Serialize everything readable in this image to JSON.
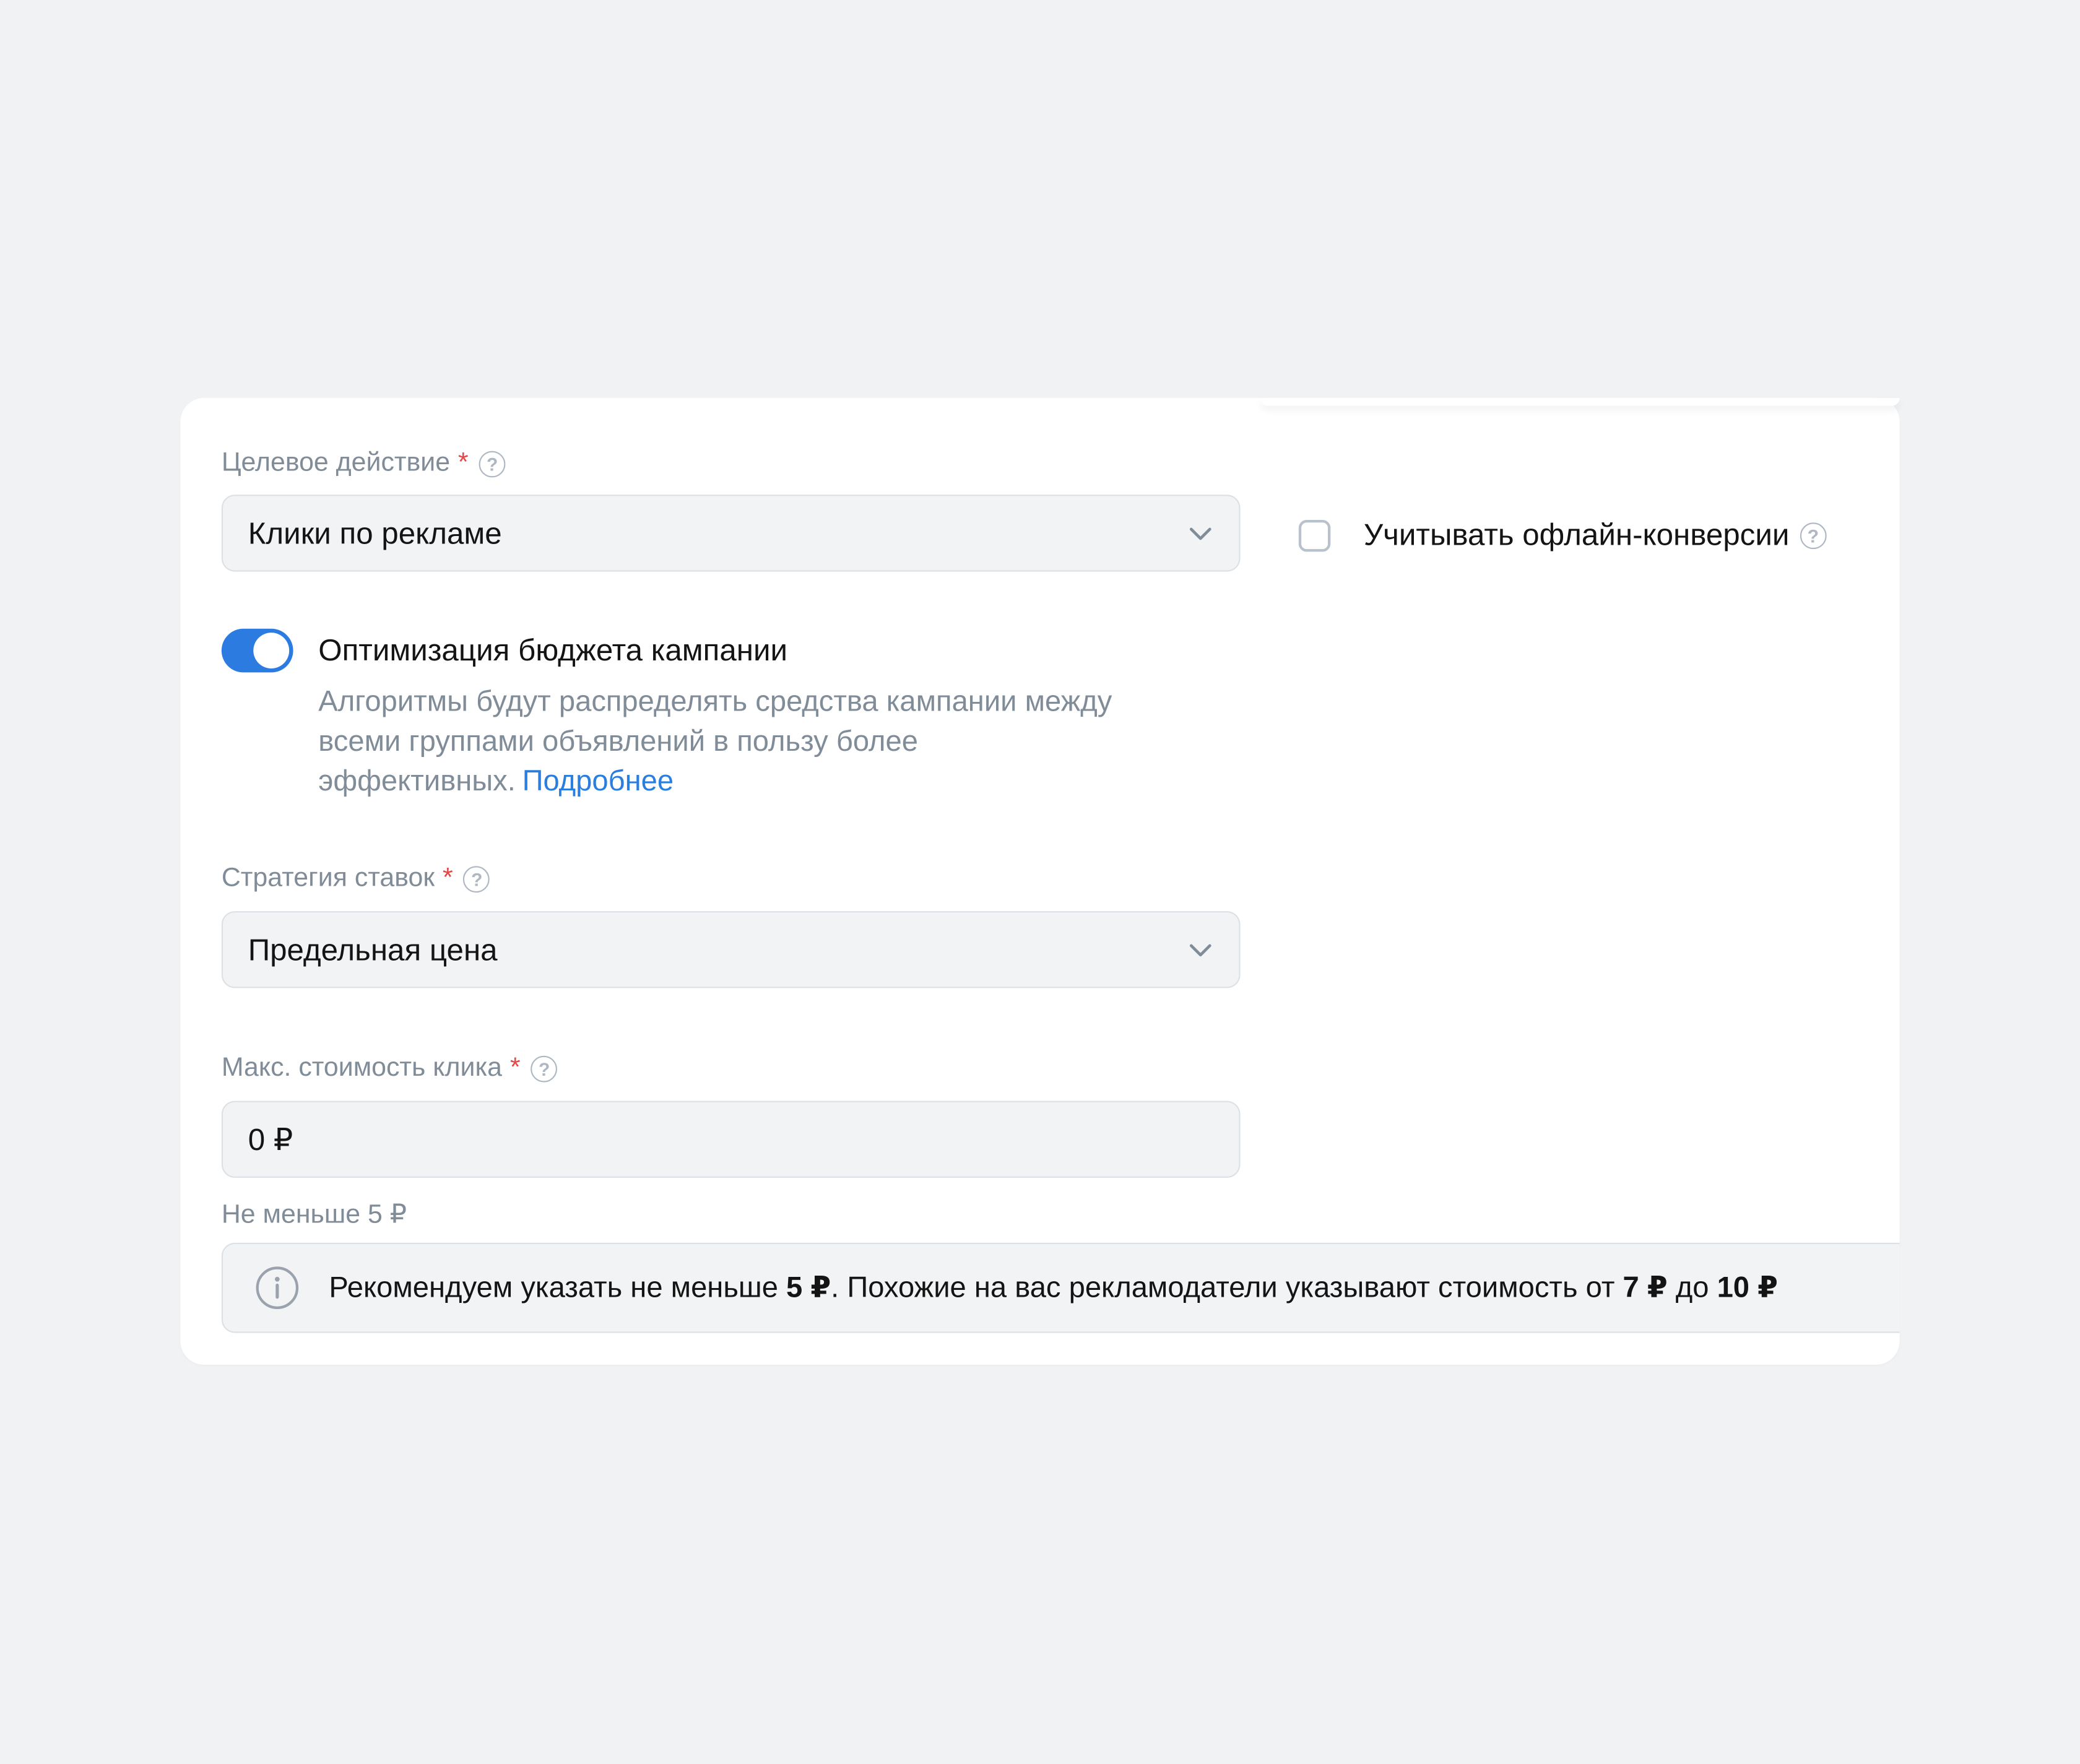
{
  "target_action": {
    "label": "Целевое действие",
    "required_mark": "*",
    "value": "Клики по рекламе"
  },
  "offline_conversions": {
    "label": "Учитывать офлайн-конверсии",
    "checked": false
  },
  "budget_optimization": {
    "title": "Оптимизация бюджета кампании",
    "description": "Алгоритмы будут распределять средства кампании между всеми группами объявлений в пользу более эффективных.",
    "link": "Подробнее",
    "enabled": true
  },
  "bid_strategy": {
    "label": "Стратегия ставок",
    "required_mark": "*",
    "value": "Предельная цена"
  },
  "max_click_cost": {
    "label": "Макс. стоимость клика",
    "required_mark": "*",
    "value": "0 ₽",
    "hint": "Не меньше 5 ₽"
  },
  "recommendation": {
    "part1": "Рекомендуем указать не меньше ",
    "min": "5 ₽",
    "part2": ". Похожие на вас рекламодатели указывают стоимость от ",
    "from": "7 ₽",
    "part3": " до ",
    "to": "10 ₽"
  },
  "colors": {
    "accent": "#2c7be0",
    "required": "#e64646",
    "secondary_text": "#818c99",
    "background": "#f1f2f4"
  },
  "icons": {
    "help": "question-circle-icon",
    "dropdown": "chevron-down-icon",
    "info": "info-circle-icon"
  }
}
